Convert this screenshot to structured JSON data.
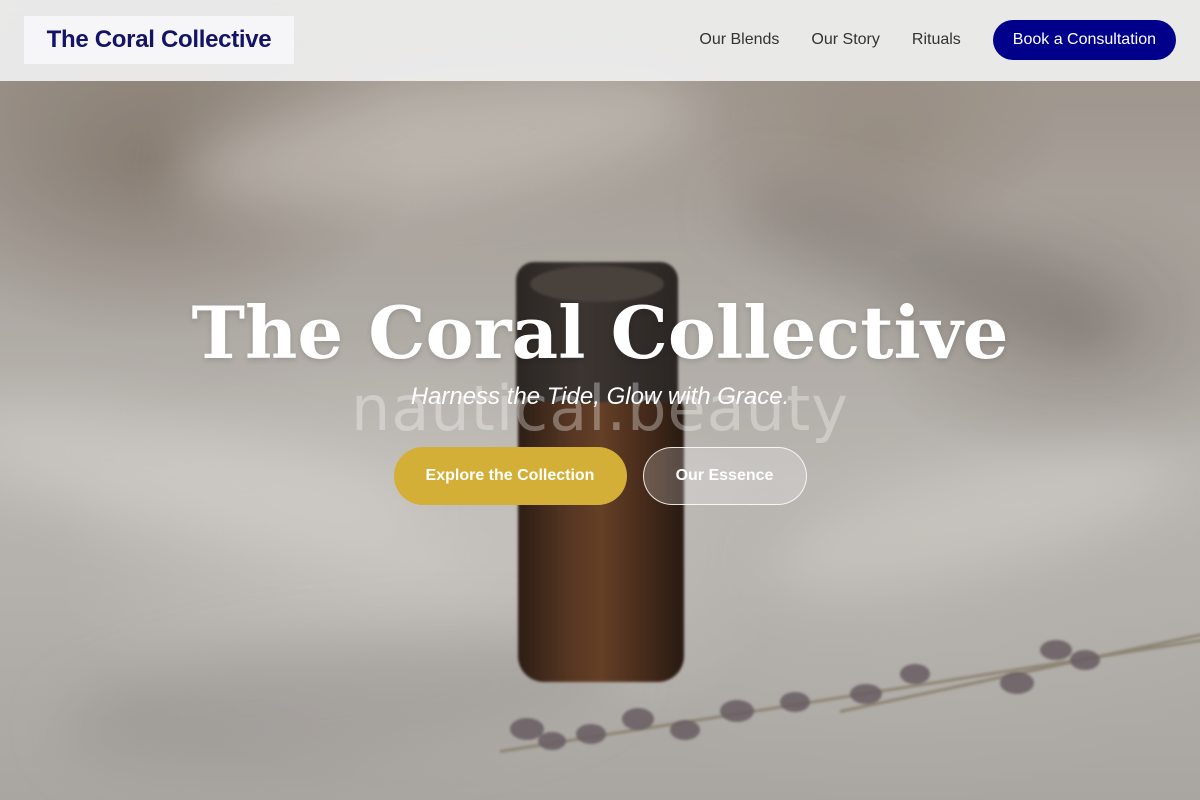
{
  "header": {
    "logo": "The Coral Collective",
    "nav": [
      {
        "label": "Our Blends"
      },
      {
        "label": "Our Story"
      },
      {
        "label": "Rituals"
      }
    ],
    "cta": "Book a Consultation"
  },
  "hero": {
    "title": "The Coral Collective",
    "subtitle": "Harness the Tide, Glow with Grace.",
    "watermark": "nautical.beauty",
    "primary_button": "Explore the Collection",
    "secondary_button": "Our Essence"
  },
  "colors": {
    "brand_navy": "#00008b",
    "logo_text": "#141466",
    "gold": "#d4af37"
  }
}
